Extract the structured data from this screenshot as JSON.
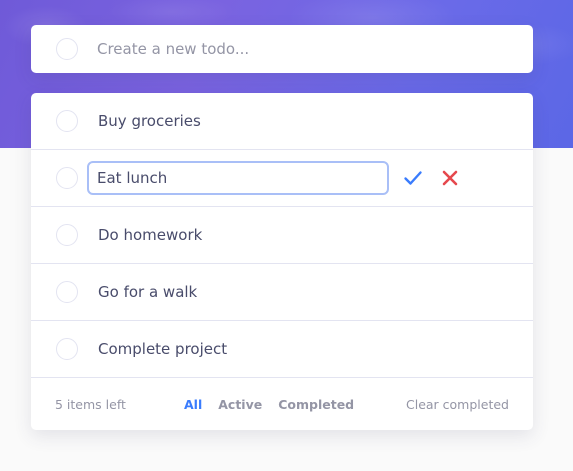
{
  "new_todo": {
    "placeholder": "Create a new todo..."
  },
  "todos": [
    {
      "label": "Buy groceries"
    },
    {
      "label": "Eat lunch",
      "editing": true
    },
    {
      "label": "Do homework"
    },
    {
      "label": "Go for a walk"
    },
    {
      "label": "Complete project"
    }
  ],
  "edit": {
    "confirm_icon": "check-icon",
    "cancel_icon": "x-icon"
  },
  "footer": {
    "items_left": "5 items left",
    "filters": [
      "All",
      "Active",
      "Completed"
    ],
    "active_filter": "All",
    "clear_label": "Clear completed"
  },
  "colors": {
    "accent": "#3a7cfd",
    "cancel": "#e5484d",
    "text": "#494c6b",
    "muted": "#9495a5"
  }
}
